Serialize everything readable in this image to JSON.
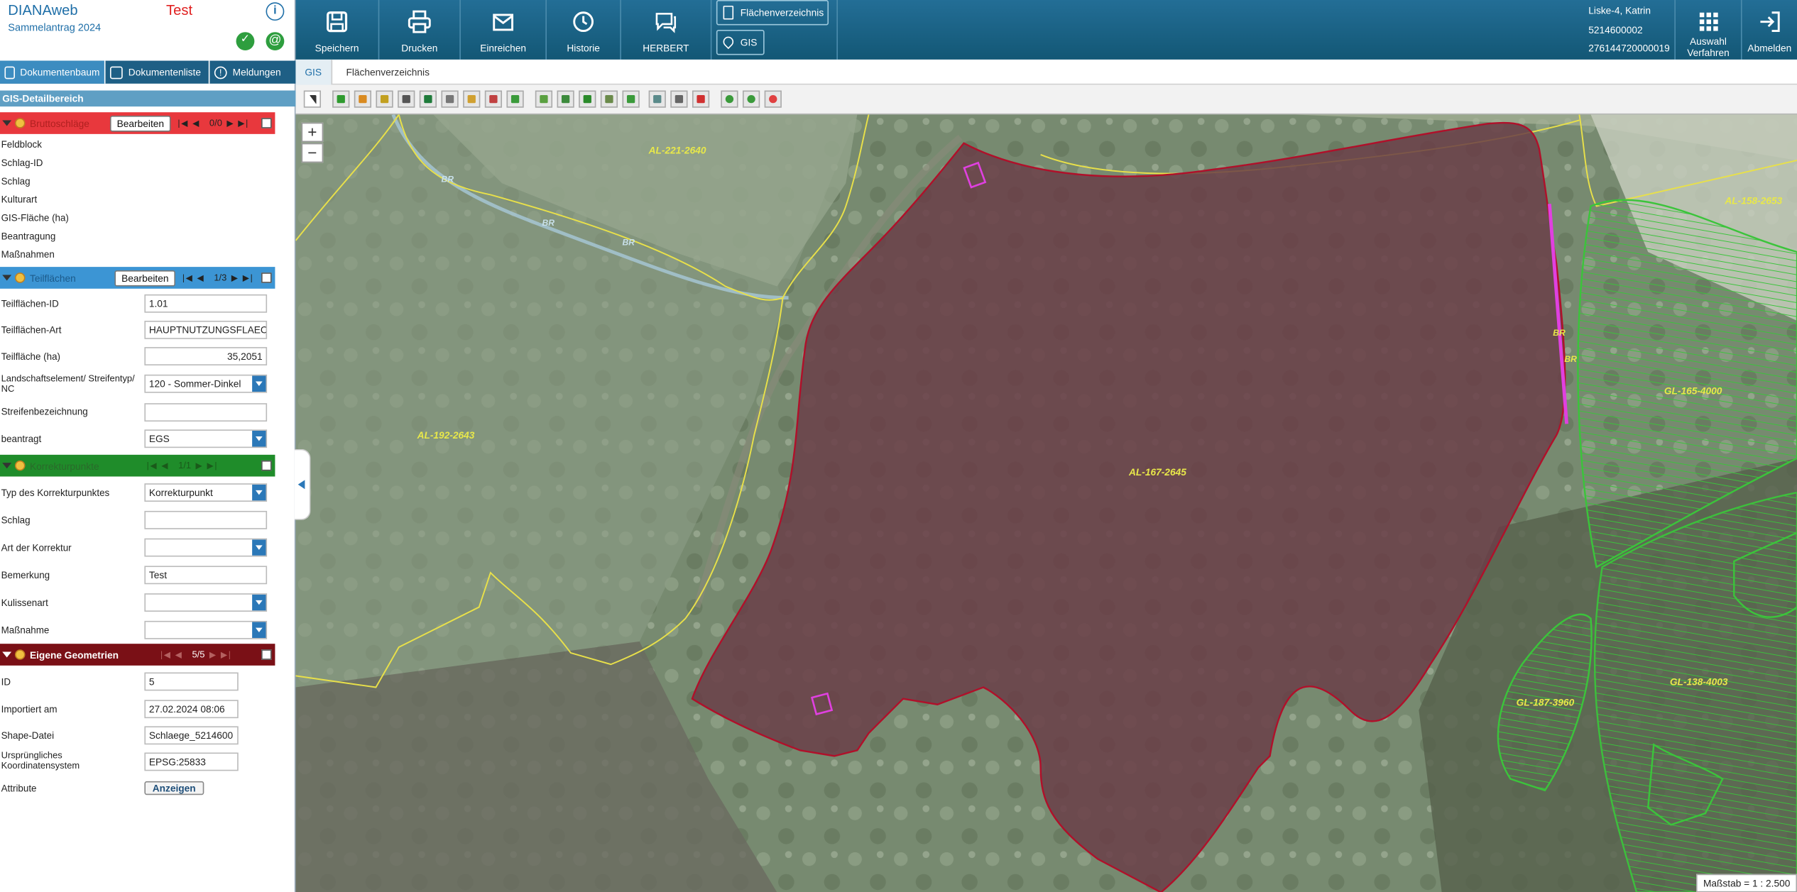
{
  "app": {
    "name": "DIANAweb",
    "subtitle": "Sammelantrag 2024",
    "mode": "Test"
  },
  "sidebar_tabs": [
    "Dokumentenbaum",
    "Dokumentenliste",
    "Meldungen"
  ],
  "gis_detail_title": "GIS-Detailbereich",
  "sections": {
    "brutto": {
      "name": "Bruttoschläge",
      "edit": "Bearbeiten",
      "count": "0/0",
      "color": "#e8383d"
    },
    "teil": {
      "name": "Teilflächen",
      "edit": "Bearbeiten",
      "count": "1/3",
      "color": "#3c95d4"
    },
    "korr": {
      "name": "Korrekturpunkte",
      "count": "1/1",
      "color": "#1f8c2a"
    },
    "eig": {
      "name": "Eigene Geometrien",
      "count": "5/5",
      "color": "#7a1016"
    }
  },
  "brutto_fields": [
    "Feldblock",
    "Schlag-ID",
    "Schlag",
    "Kulturart",
    "GIS-Fläche (ha)",
    "Beantragung",
    "Maßnahmen"
  ],
  "teil_fields": {
    "id_label": "Teilflächen-ID",
    "id_value": "1.01",
    "art_label": "Teilflächen-Art",
    "art_value": "HAUPTNUTZUNGSFLAECHE",
    "flaeche_label": "Teilfläche (ha)",
    "flaeche_value": "35,2051",
    "landschaft_label": "Landschaftselement/ Streifentyp/ NC",
    "landschaft_value": "120 - Sommer-Dinkel",
    "streifen_label": "Streifenbezeichnung",
    "streifen_value": "",
    "beantragt_label": "beantragt",
    "beantragt_value": "EGS"
  },
  "korr_fields": {
    "typ_label": "Typ des Korrekturpunktes",
    "typ_value": "Korrekturpunkt",
    "schlag_label": "Schlag",
    "schlag_value": "",
    "art_label": "Art der Korrektur",
    "art_value": "",
    "bemerkung_label": "Bemerkung",
    "bemerkung_value": "Test",
    "kulisse_label": "Kulissenart",
    "kulisse_value": "",
    "massnahme_label": "Maßnahme",
    "massnahme_value": ""
  },
  "eig_fields": {
    "id_label": "ID",
    "id_value": "5",
    "import_label": "Importiert am",
    "import_value": "27.02.2024 08:06",
    "shape_label": "Shape-Datei",
    "shape_value": "Schlaege_5214600",
    "koord_label": "Ursprüngliches Koordinatensystem",
    "koord_value": "EPSG:25833",
    "attr_label": "Attribute",
    "attr_button": "Anzeigen"
  },
  "toolbar": {
    "speichern": "Speichern",
    "drucken": "Drucken",
    "einreichen": "Einreichen",
    "historie": "Historie",
    "herbert": "HERBERT",
    "flaechenverzeichnis": "Flächenverzeichnis",
    "gis": "GIS",
    "auswahl": "Auswahl Verfahren",
    "abmelden": "Abmelden"
  },
  "user": {
    "name": "Liske-4, Katrin",
    "betrieb": "5214600002",
    "nummer": "276144720000019"
  },
  "content_tabs": [
    "GIS",
    "Flächenverzeichnis"
  ],
  "map": {
    "labels": [
      "AL-221-2640",
      "AL-192-2643",
      "AL-167-2645",
      "AL-158-2653",
      "GL-165-4000",
      "GL-187-3960",
      "GL-138-4003",
      "BR",
      "BR",
      "BR",
      "BR",
      "BR"
    ],
    "scale": "Maßstab = 1 : 2.500"
  },
  "colors": {
    "header": "#1b6689",
    "selected_parcel": "#7a1420",
    "parcel_border": "#e8e04a",
    "grassland": "#3bc43b"
  }
}
